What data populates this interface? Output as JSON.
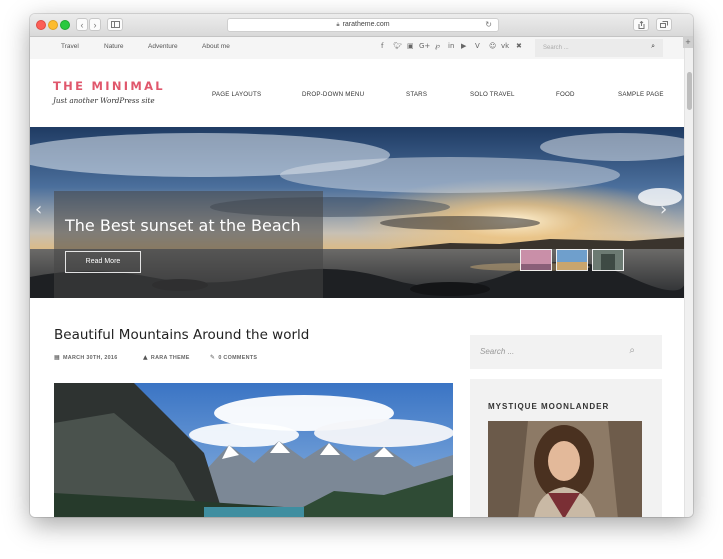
{
  "browser": {
    "url": "raratheme.com",
    "back": "‹",
    "forward": "›",
    "new_tab": "+"
  },
  "topbar": {
    "links": [
      "Travel",
      "Nature",
      "Adventure",
      "About me"
    ],
    "social_icons": [
      "facebook-icon",
      "twitter-icon",
      "instagram-icon",
      "google-plus-icon",
      "pinterest-icon",
      "linkedin-icon",
      "youtube-icon",
      "vimeo-icon",
      "odnoklassniki-icon",
      "vk-icon",
      "xing-icon"
    ],
    "search_placeholder": "Search ..."
  },
  "header": {
    "site_title": "THE MINIMAL",
    "tagline": "Just another WordPress site",
    "accent_color": "#e0576c",
    "nav": [
      "PAGE LAYOUTS",
      "DROP-DOWN MENU",
      "STARS",
      "SOLO TRAVEL",
      "FOOD",
      "SAMPLE PAGE"
    ]
  },
  "slider": {
    "caption": "The Best sunset at the Beach",
    "button": "Read More",
    "thumbnail_count": 3
  },
  "post": {
    "title": "Beautiful Mountains Around the world",
    "date": "MARCH 30TH, 2016",
    "author": "RARA THEME",
    "comments": "0 COMMENTS"
  },
  "sidebar": {
    "search_placeholder": "Search ...",
    "widget_title": "MYSTIQUE MOONLANDER"
  }
}
